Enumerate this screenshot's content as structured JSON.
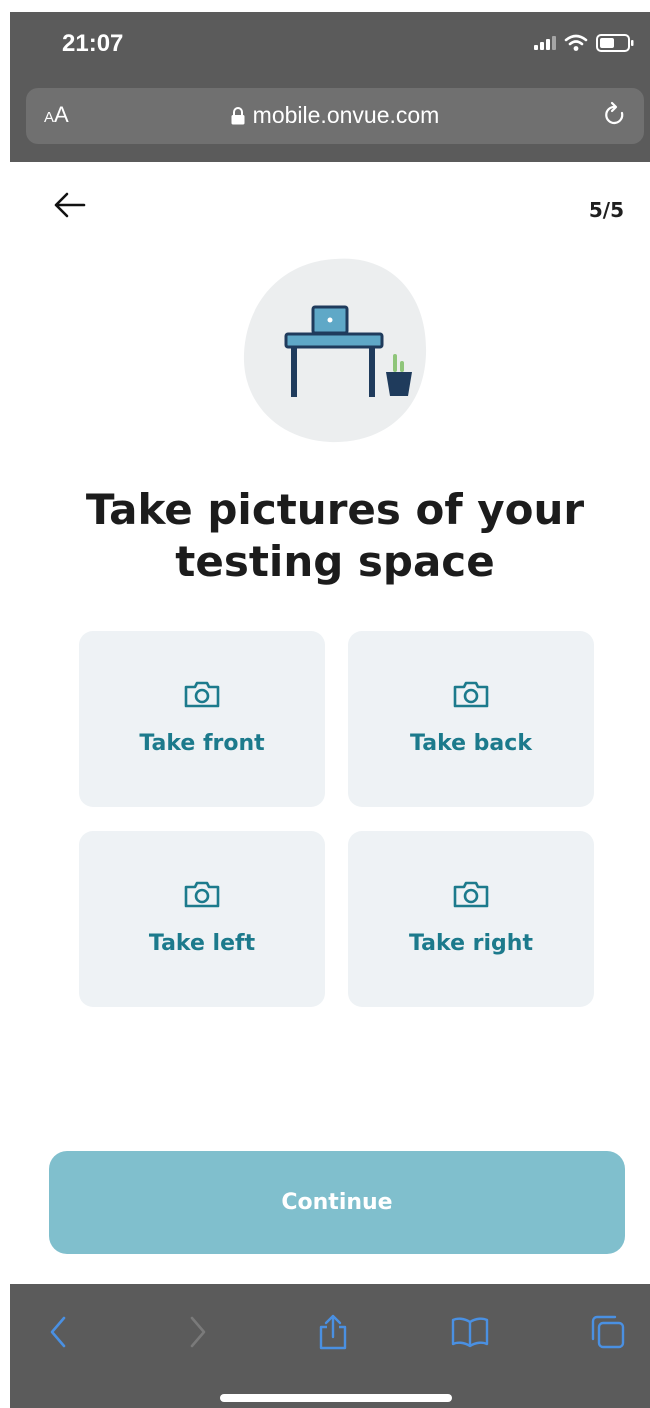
{
  "browser": {
    "time": "21:07",
    "text_size_label_small": "A",
    "text_size_label_large": "A",
    "url": "mobile.onvue.com"
  },
  "header": {
    "step": "5/5"
  },
  "main": {
    "title_line1": "Take pictures of your",
    "title_line2": "testing space",
    "tiles": [
      {
        "label": "Take front",
        "icon": "camera-icon"
      },
      {
        "label": "Take back",
        "icon": "camera-icon"
      },
      {
        "label": "Take left",
        "icon": "camera-icon"
      },
      {
        "label": "Take right",
        "icon": "camera-icon"
      }
    ],
    "continue_label": "Continue"
  },
  "colors": {
    "accent": "#1c7a8c",
    "button": "#80bfcd",
    "tile_bg": "#eef2f5",
    "browser_chrome": "#5b5b5b",
    "browser_link": "#4a90e2"
  }
}
